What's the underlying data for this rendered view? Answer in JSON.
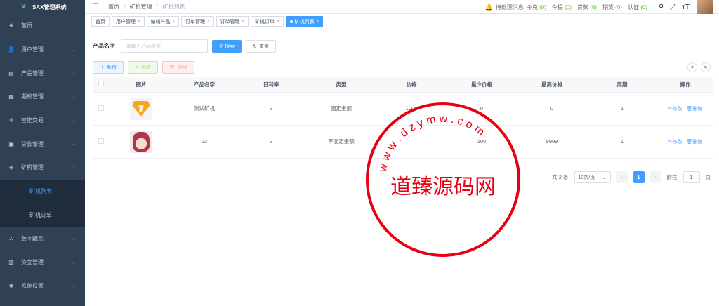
{
  "sidebar": {
    "title": "SAX管理系统",
    "items": [
      {
        "label": "首页",
        "icon": "dashboard-icon",
        "glyph": "❖",
        "arrow": false
      },
      {
        "label": "用户管理",
        "icon": "user-icon",
        "glyph": "👤",
        "arrow": true
      },
      {
        "label": "产品管理",
        "icon": "document-icon",
        "glyph": "▤",
        "arrow": true
      },
      {
        "label": "期权管理",
        "icon": "chart-icon",
        "glyph": "▦",
        "arrow": true
      },
      {
        "label": "智能交易",
        "icon": "gear-icon",
        "glyph": "✲",
        "arrow": true
      },
      {
        "label": "贷款管理",
        "icon": "wallet-icon",
        "glyph": "▣",
        "arrow": true
      },
      {
        "label": "矿机管理",
        "icon": "stack-icon",
        "glyph": "◈",
        "arrow": true,
        "open": true
      }
    ],
    "sub_items": [
      {
        "label": "矿机列表",
        "active": true
      },
      {
        "label": "矿机订单",
        "active": false
      }
    ],
    "items_after": [
      {
        "label": "数字藏品",
        "icon": "share-icon",
        "glyph": "⛬",
        "arrow": true
      },
      {
        "label": "资金管理",
        "icon": "money-icon",
        "glyph": "▥",
        "arrow": true
      },
      {
        "label": "系统设置",
        "icon": "settings-icon",
        "glyph": "✺",
        "arrow": true
      }
    ]
  },
  "navbar": {
    "breadcrumb": [
      "首页",
      "矿机管理",
      "矿机列表"
    ],
    "notice_label": "待处理消息",
    "stats": [
      {
        "label": "今充",
        "value": "(0)"
      },
      {
        "label": "今提",
        "value": "(0)"
      },
      {
        "label": "贷款",
        "value": "(0)"
      },
      {
        "label": "期货",
        "value": "(0)"
      },
      {
        "label": "认证",
        "value": "(0)"
      }
    ]
  },
  "tags": [
    {
      "label": "首页",
      "closable": false,
      "active": false
    },
    {
      "label": "用户管理",
      "closable": true,
      "active": false
    },
    {
      "label": "编辑产品",
      "closable": true,
      "active": false
    },
    {
      "label": "订单管理",
      "closable": true,
      "active": false
    },
    {
      "label": "订单管理",
      "closable": true,
      "active": false
    },
    {
      "label": "矿机订单",
      "closable": true,
      "active": false
    },
    {
      "label": "矿机列表",
      "closable": true,
      "active": true
    }
  ],
  "search": {
    "label": "产品名字",
    "placeholder": "请输入产品名字",
    "search_btn": "搜索",
    "reset_btn": "重置"
  },
  "toolbar": {
    "add": "新增",
    "edit": "修改",
    "delete": "删除"
  },
  "table": {
    "columns": [
      "",
      "图片",
      "产品名字",
      "日利率",
      "类型",
      "价格",
      "最少价格",
      "最高价格",
      "周期",
      "操作"
    ],
    "rows": [
      {
        "name": "测试矿机",
        "rate": "2",
        "type": "固定金额",
        "price": "1000",
        "min": "0",
        "max": "0",
        "period": "1",
        "img": "tether"
      },
      {
        "name": "22",
        "rate": "2",
        "type": "不固定金额",
        "price": "",
        "min": "100",
        "max": "9999",
        "period": "1",
        "img": "anime"
      }
    ],
    "op_edit": "修改",
    "op_delete": "删除"
  },
  "pager": {
    "total": "共 2 条",
    "size": "10条/页",
    "current": "1",
    "goto": "前往",
    "goto_value": "1",
    "page_unit": "页"
  },
  "watermark": {
    "center": "道臻源码网",
    "ring_text": "www.dzymw.com"
  }
}
